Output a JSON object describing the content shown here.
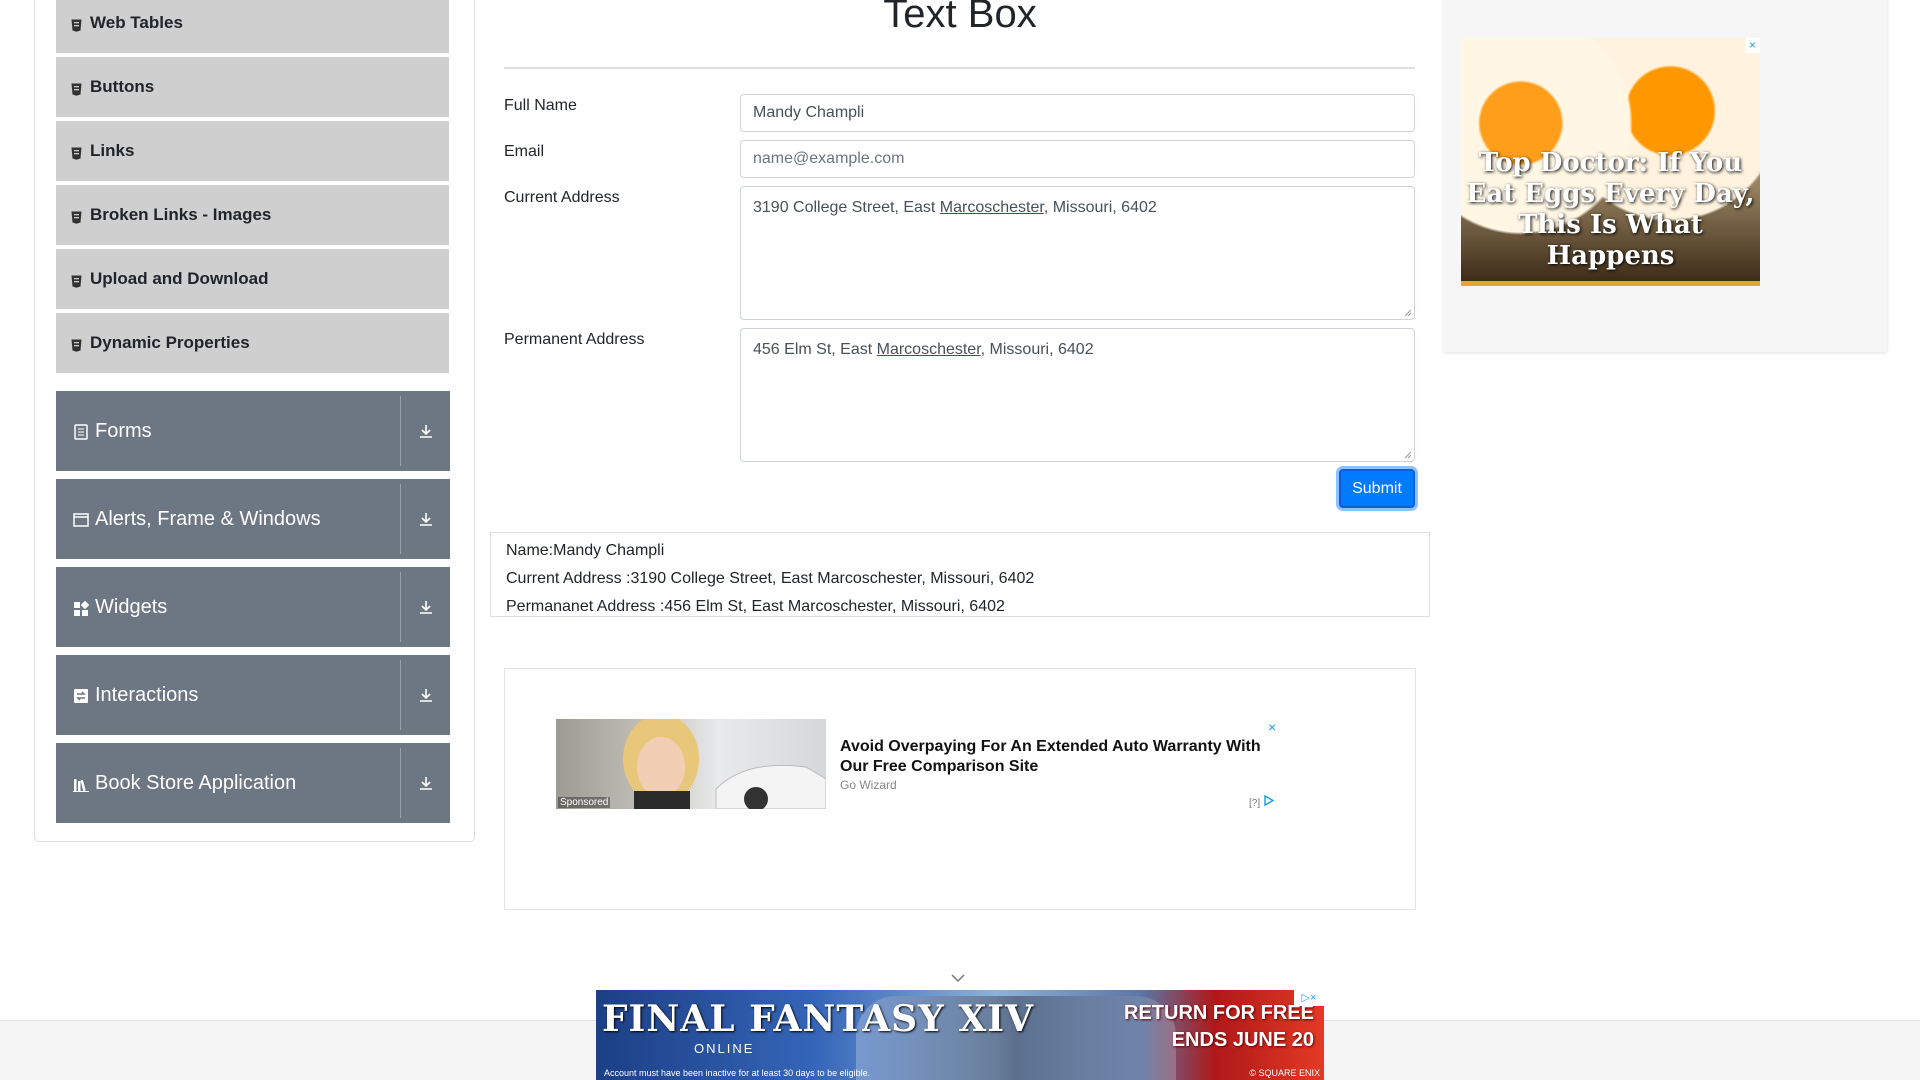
{
  "sidebar": {
    "sub_items": [
      {
        "label": "Web Tables"
      },
      {
        "label": "Buttons"
      },
      {
        "label": "Links"
      },
      {
        "label": "Broken Links - Images"
      },
      {
        "label": "Upload and Download"
      },
      {
        "label": "Dynamic Properties"
      }
    ],
    "groups": [
      {
        "label": "Forms",
        "icon": "form-icon"
      },
      {
        "label": "Alerts, Frame & Windows",
        "icon": "window-icon"
      },
      {
        "label": "Widgets",
        "icon": "widgets-icon"
      },
      {
        "label": "Interactions",
        "icon": "interactions-icon"
      },
      {
        "label": "Book Store Application",
        "icon": "book-icon"
      }
    ]
  },
  "main": {
    "title": "Text Box",
    "full_name": {
      "label": "Full Name",
      "value": "Mandy Champli",
      "placeholder": "Full Name"
    },
    "email": {
      "label": "Email",
      "value": "",
      "placeholder": "name@example.com"
    },
    "current_address": {
      "label": "Current Address",
      "value_prefix": "3190 College Street, East ",
      "value_word": "Marcoschester",
      "value_suffix": ", Missouri, 6402"
    },
    "permanent_address": {
      "label": "Permanent Address",
      "value_prefix": "456 Elm St, East ",
      "value_word": "Marcoschester",
      "value_suffix": ", Missouri, 6402"
    },
    "submit_label": "Submit",
    "output": {
      "name": "Name:Mandy Champli",
      "current_address": "Current Address :3190 College Street, East Marcoschester, Missouri, 6402",
      "permanent_address": "Permananet Address :456 Elm St, East Marcoschester, Missouri, 6402"
    }
  },
  "ads": {
    "middle": {
      "headline": "Avoid Overpaying For An Extended Auto Warranty With Our Free Comparison Site",
      "brand": "Go Wizard",
      "sponsored": "Sponsored",
      "close": "×",
      "info": "[?]"
    },
    "right": {
      "headline": "Top Doctor: If You Eat Eggs Every Day, This Is What Happens",
      "close": "×"
    },
    "bottom": {
      "logo": "FINAL FANTASY XIV",
      "logo_sub": "ONLINE",
      "promo_line1": "RETURN FOR FREE",
      "promo_line2": "ENDS JUNE 20",
      "fine_print": "Account must have been inactive for at least 30 days to be eligible.",
      "copyright": "© SQUARE ENIX",
      "close": "▷×"
    }
  },
  "colors": {
    "sidebar_group_bg": "#6d7683",
    "sidebar_sub_bg": "#cfcfcf",
    "accent": "#007bff"
  }
}
